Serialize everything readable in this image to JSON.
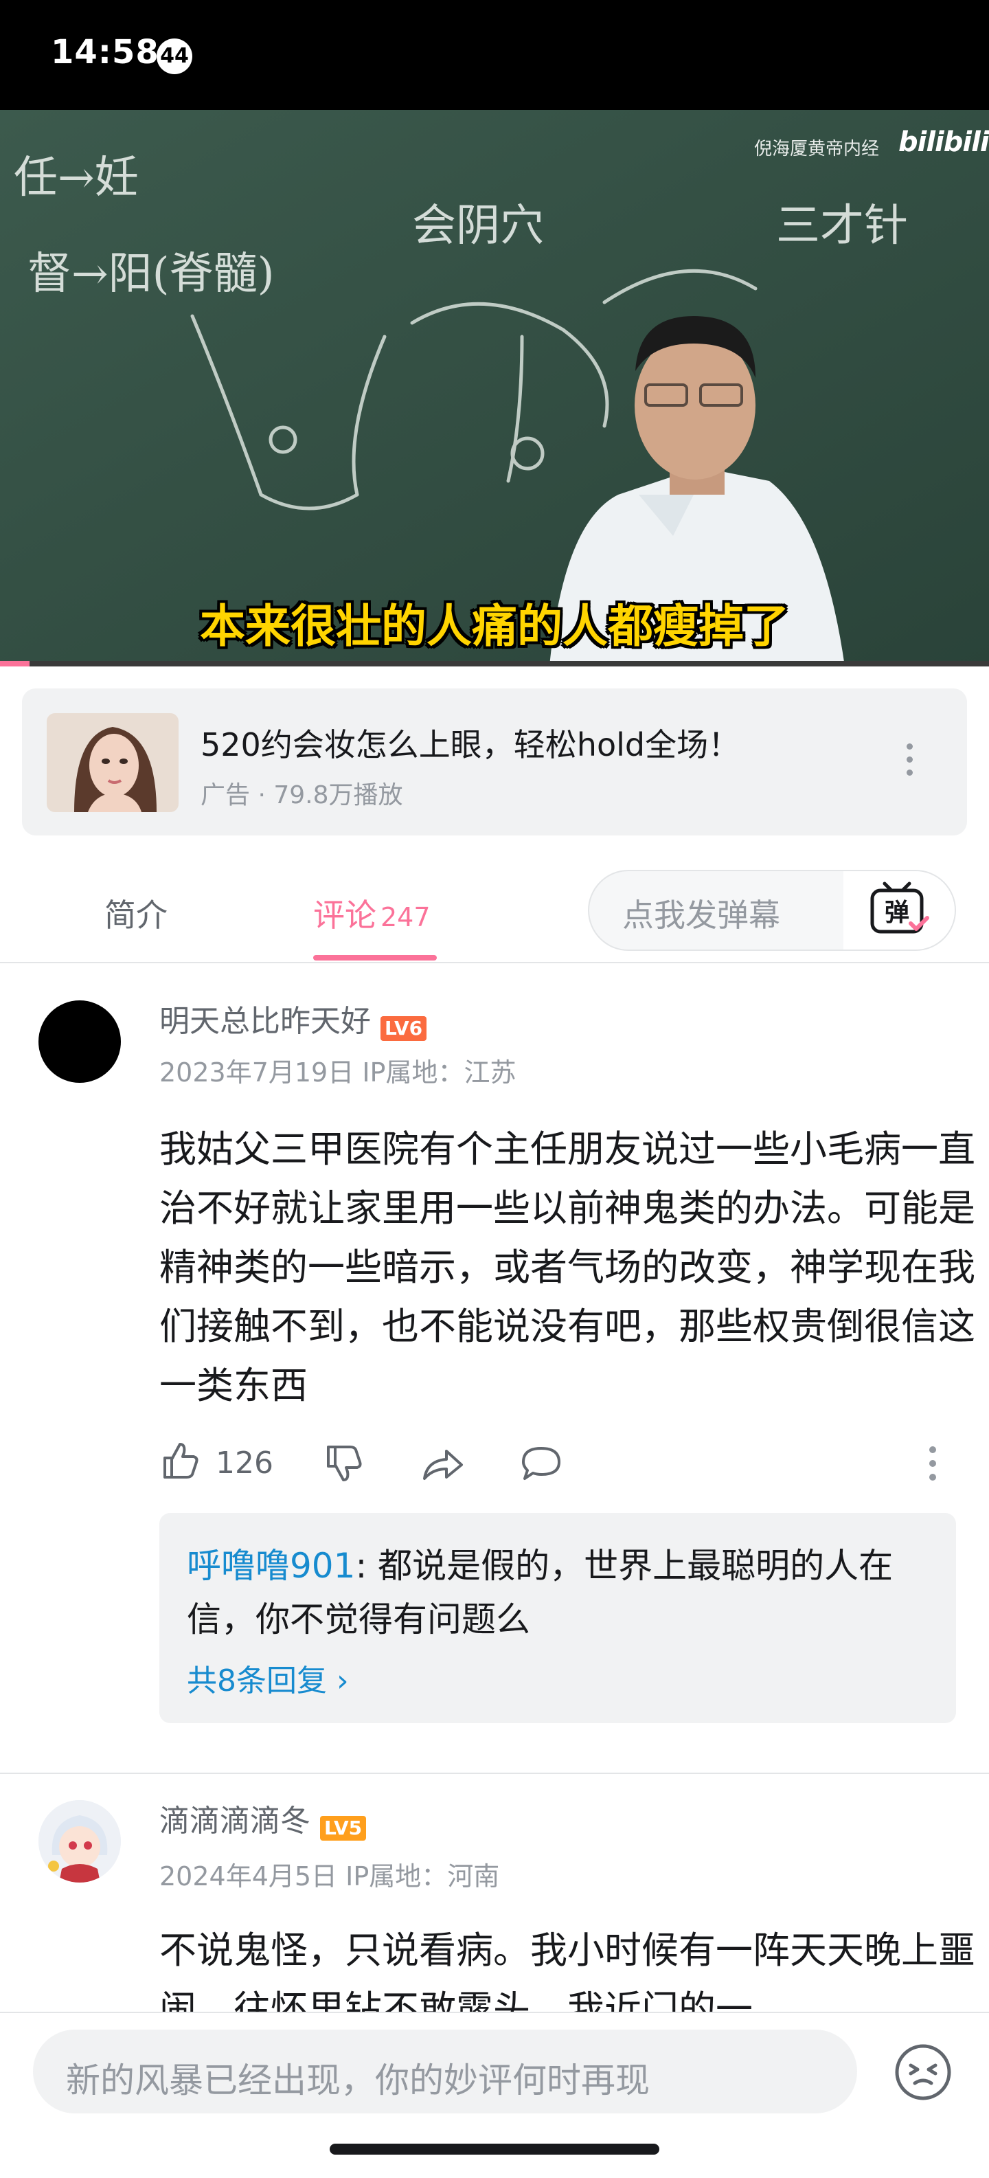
{
  "status_bar": {
    "time": "14:58",
    "notification_count": "44"
  },
  "video": {
    "watermark_text": "倪海厦黄帝内经",
    "watermark_logo": "bilibili",
    "subtitle": "本来很壮的人痛的人都瘦掉了",
    "blackboard_text": [
      "任→妊",
      "督→阳(脊髓)",
      "会阴穴",
      "三才针"
    ],
    "progress": 0.03
  },
  "ad": {
    "title": "520约会妆怎么上眼，轻松hold全场！",
    "subtitle": "广告 · 79.8万播放"
  },
  "tabs": {
    "intro": "简介",
    "comments": "评论",
    "comments_count": "247",
    "danmaku_placeholder": "点我发弹幕",
    "danmaku_icon": "弹"
  },
  "comments": [
    {
      "username": "明天总比昨天好",
      "level": "LV6",
      "meta": "2023年7月19日 IP属地：江苏",
      "text": "我姑父三甲医院有个主任朋友说过一些小毛病一直治不好就让家里用一些以前神鬼类的办法。可能是精神类的一些暗示，或者气场的改变，神学现在我们接触不到，也不能说没有吧，那些权贵倒很信这一类东西",
      "likes": "126",
      "reply": {
        "user": "呼噜噜901",
        "text": ": 都说是假的，世界上最聪明的人在信，你不觉得有问题么",
        "more": "共8条回复 ›"
      }
    },
    {
      "username": "滴滴滴滴冬",
      "level": "LV5",
      "meta": "2024年4月5日 IP属地：河南",
      "text": "不说鬼怪，只说看病。我小时候有一阵天天晚上噩闹，往怀里钻不敢露头，我近门的一"
    }
  ],
  "bottom": {
    "input_placeholder": "新的风暴已经出现，你的妙评何时再现"
  },
  "colors": {
    "accent": "#fb7299",
    "link": "#178bcf",
    "muted": "#9499a0"
  }
}
